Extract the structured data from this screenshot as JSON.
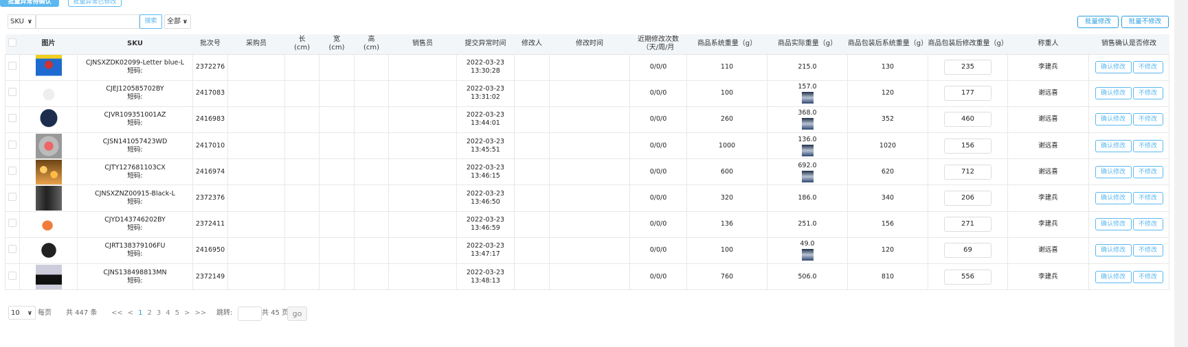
{
  "toolbar": {
    "batch_pending_label": "批量异常待确认",
    "batch_modified_label": "批量异常已修改",
    "search_field": "SKU",
    "search_value": "",
    "search_button": "搜索",
    "filter_select": "全部",
    "batch_modify": "批量修改",
    "batch_no_modify": "批量不修改"
  },
  "table": {
    "headers": [
      "图片",
      "SKU",
      "批次号",
      "采购员",
      "长\n(cm)",
      "宽\n(cm)",
      "高\n(cm)",
      "销售员",
      "提交异常时间",
      "修改人",
      "修改时间",
      "近期修改次数（天/周/月",
      "商品系统重量（g）",
      "商品实际重量（g）",
      "商品包装后系统重量（g）",
      "商品包装后修改重量（g）",
      "称重人",
      "销售确认是否修改"
    ],
    "short_code_label": "短码:",
    "confirm_label": "确认修改",
    "no_modify_label": "不修改",
    "rows": [
      {
        "sku": "CJNSXZDK02099-Letter blue-L",
        "batch": "2372276",
        "date": "2022-03-23",
        "time": "13:30:28",
        "recent": "0/0/0",
        "sys_weight": "110",
        "actual_weight": "215.0",
        "has_photo": false,
        "pkg_sys_weight": "130",
        "pkg_mod_weight": "235",
        "weigher": "李建兵",
        "img": "shorts"
      },
      {
        "sku": "CJEJ120585702BY",
        "batch": "2417083",
        "date": "2022-03-23",
        "time": "13:31:02",
        "recent": "0/0/0",
        "sys_weight": "100",
        "actual_weight": "157.0",
        "has_photo": true,
        "pkg_sys_weight": "120",
        "pkg_mod_weight": "177",
        "weigher": "谢远喜",
        "img": "earbud"
      },
      {
        "sku": "CJVR109351001AZ",
        "batch": "2416983",
        "date": "2022-03-23",
        "time": "13:44:01",
        "recent": "0/0/0",
        "sys_weight": "260",
        "actual_weight": "368.0",
        "has_photo": true,
        "pkg_sys_weight": "352",
        "pkg_mod_weight": "460",
        "weigher": "谢远喜",
        "img": "vr"
      },
      {
        "sku": "CJSN141057423WD",
        "batch": "2417010",
        "date": "2022-03-23",
        "time": "13:45:51",
        "recent": "0/0/0",
        "sys_weight": "1000",
        "actual_weight": "136.0",
        "has_photo": true,
        "pkg_sys_weight": "1020",
        "pkg_mod_weight": "156",
        "weigher": "谢远喜",
        "img": "led"
      },
      {
        "sku": "CJTY127681103CX",
        "batch": "2416974",
        "date": "2022-03-23",
        "time": "13:46:15",
        "recent": "0/0/0",
        "sys_weight": "600",
        "actual_weight": "692.0",
        "has_photo": true,
        "pkg_sys_weight": "620",
        "pkg_mod_weight": "712",
        "weigher": "谢远喜",
        "img": "lights"
      },
      {
        "sku": "CJNSXZNZ00915-Black-L",
        "batch": "2372376",
        "date": "2022-03-23",
        "time": "13:46:50",
        "recent": "0/0/0",
        "sys_weight": "320",
        "actual_weight": "186.0",
        "has_photo": false,
        "pkg_sys_weight": "340",
        "pkg_mod_weight": "206",
        "weigher": "李建兵",
        "img": "pants"
      },
      {
        "sku": "CJYD143746202BY",
        "batch": "2372411",
        "date": "2022-03-23",
        "time": "13:46:59",
        "recent": "0/0/0",
        "sys_weight": "136",
        "actual_weight": "251.0",
        "has_photo": false,
        "pkg_sys_weight": "156",
        "pkg_mod_weight": "271",
        "weigher": "李建兵",
        "img": "lamp"
      },
      {
        "sku": "CJRT138379106FU",
        "batch": "2416950",
        "date": "2022-03-23",
        "time": "13:47:17",
        "recent": "0/0/0",
        "sys_weight": "100",
        "actual_weight": "49.0",
        "has_photo": true,
        "pkg_sys_weight": "120",
        "pkg_mod_weight": "69",
        "weigher": "谢远喜",
        "img": "hair"
      },
      {
        "sku": "CJNS138498813MN",
        "batch": "2372149",
        "date": "2022-03-23",
        "time": "13:48:13",
        "recent": "0/0/0",
        "sys_weight": "760",
        "actual_weight": "506.0",
        "has_photo": false,
        "pkg_sys_weight": "810",
        "pkg_mod_weight": "556",
        "weigher": "李建兵",
        "img": "shoes"
      }
    ]
  },
  "pagination": {
    "page_size": "10",
    "per_page_label": "每页",
    "total_label": "共 447 条",
    "first": "<<",
    "prev": "<",
    "pages": [
      "1",
      "2",
      "3",
      "4",
      "5"
    ],
    "next": ">",
    "last": ">>",
    "jump_label": "跳转:",
    "total_pages_label": "共 45 页",
    "go_label": "go"
  },
  "colors": {
    "accent": "#5bb8f0",
    "header_bg": "#f3f6f9"
  }
}
